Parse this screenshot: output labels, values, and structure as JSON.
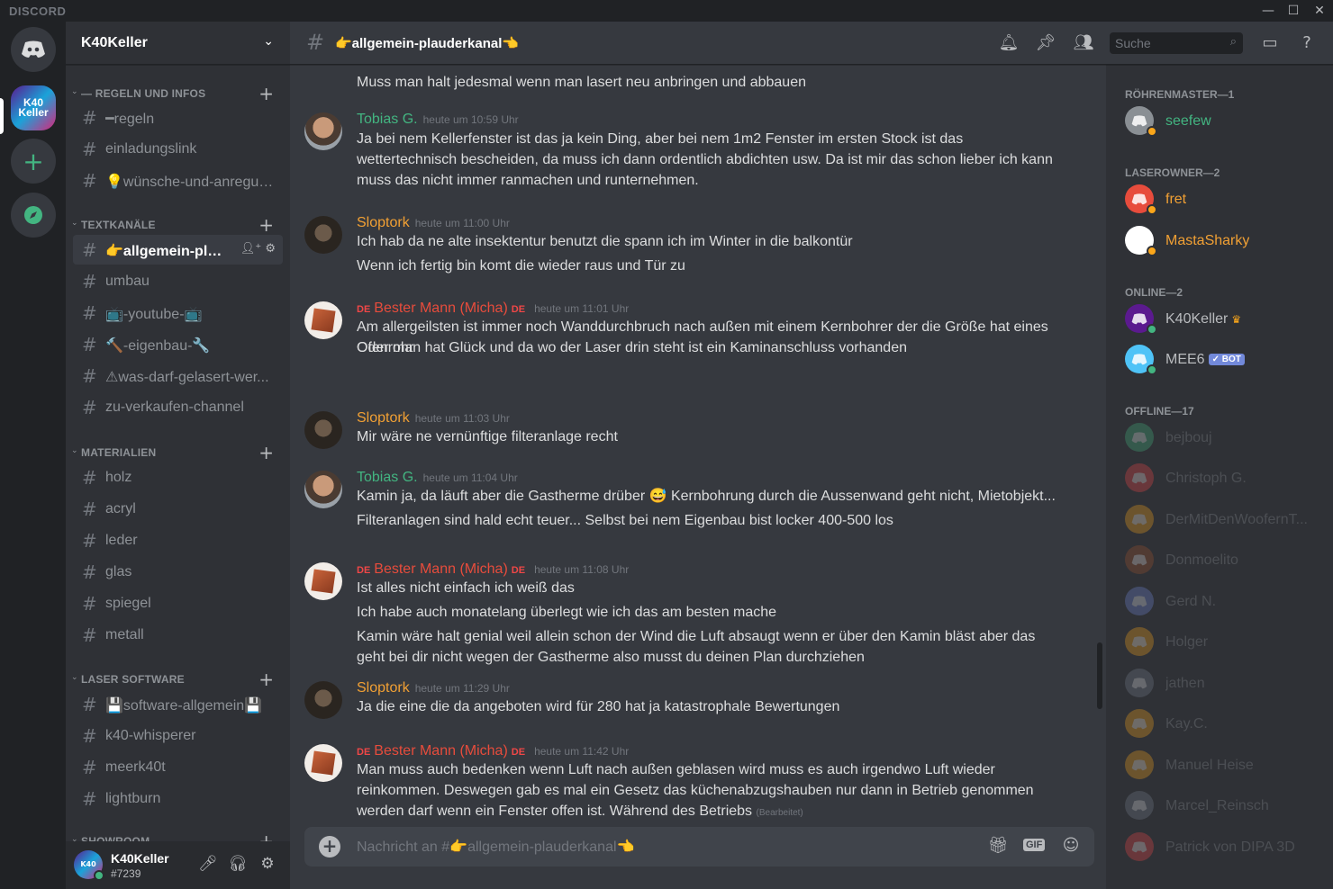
{
  "window": {
    "brand": "DISCORD",
    "minimize": "—",
    "maximize": "☐",
    "close": "✕"
  },
  "guild": {
    "name": "K40Keller",
    "icon_text": "K40\nKeller"
  },
  "categories": [
    {
      "label": "— REGELN UND INFOS",
      "channels": [
        {
          "name": "━regeln"
        },
        {
          "name": "einladungslink"
        },
        {
          "name": "💡wünsche-und-anregun..."
        }
      ]
    },
    {
      "label": "TEXTKANÄLE",
      "channels": [
        {
          "name": "👉allgemein-plaud...",
          "active": true
        },
        {
          "name": "umbau"
        },
        {
          "name": "📺-youtube-📺"
        },
        {
          "name": "🔨-eigenbau-🔧"
        },
        {
          "name": "⚠was-darf-gelasert-wer..."
        },
        {
          "name": "zu-verkaufen-channel"
        }
      ]
    },
    {
      "label": "MATERIALIEN",
      "channels": [
        {
          "name": "holz"
        },
        {
          "name": "acryl"
        },
        {
          "name": "leder"
        },
        {
          "name": "glas"
        },
        {
          "name": "spiegel"
        },
        {
          "name": "metall"
        }
      ]
    },
    {
      "label": "LASER SOFTWARE",
      "channels": [
        {
          "name": "💾software-allgemein💾"
        },
        {
          "name": "k40-whisperer"
        },
        {
          "name": "meerk40t"
        },
        {
          "name": "lightburn"
        }
      ]
    },
    {
      "label": "SHOWROOM",
      "channels": []
    }
  ],
  "user_panel": {
    "name": "K40Keller",
    "tag": "#7239"
  },
  "topbar": {
    "channel": "👉allgemein-plauderkanal👈",
    "search_placeholder": "Suche"
  },
  "messages": [
    {
      "text_lines": [
        "Muss man halt jedesmal wenn man lasert neu anbringen und abbauen"
      ]
    },
    {
      "author": "Tobias G.",
      "color": "#43b581",
      "ts": "heute um 10:59 Uhr",
      "avatar": "tobias",
      "text_lines": [
        "Ja bei nem Kellerfenster ist das ja kein Ding, aber bei nem 1m2 Fenster im ersten Stock ist das wettertechnisch bescheiden, da muss ich dann ordentlich abdichten usw. Da ist mir das schon lieber ich kann muss das nicht immer ranmachen und runternehmen."
      ]
    },
    {
      "author": "Sloptork",
      "color": "#f1a034",
      "ts": "heute um 11:00 Uhr",
      "avatar": "sloptork",
      "text_lines": [
        "Ich hab da ne alte insektentur benutzt die spann ich im Winter in die balkontür",
        "Wenn ich fertig bin komt die wieder raus und Tür zu"
      ]
    },
    {
      "author": "Bester Mann (Micha)",
      "color": "#e74c3c",
      "ts": "heute um 11:01 Uhr",
      "avatar": "micha",
      "flag": "DE",
      "text_lines": [
        "Am allergeilsten ist immer noch Wanddurchbruch nach außen mit einem Kernbohrer der die Größe hat eines Ofenrohr",
        "Oder man hat Glück und da wo der Laser drin steht ist ein Kaminanschluss vorhanden"
      ]
    },
    {
      "author": "Sloptork",
      "color": "#f1a034",
      "ts": "heute um 11:03 Uhr",
      "avatar": "sloptork",
      "text_lines": [
        "Mir wäre ne vernünftige filteranlage recht"
      ]
    },
    {
      "author": "Tobias G.",
      "color": "#43b581",
      "ts": "heute um 11:04 Uhr",
      "avatar": "tobias",
      "text_lines": [
        "Kamin ja, da läuft aber die Gastherme drüber 😅 Kernbohrung durch die Aussenwand geht nicht, Mietobjekt...",
        "Filteranlagen sind hald echt teuer... Selbst bei nem Eigenbau bist locker 400-500 los"
      ]
    },
    {
      "author": "Bester Mann (Micha)",
      "color": "#e74c3c",
      "ts": "heute um 11:08 Uhr",
      "avatar": "micha",
      "flag": "DE",
      "text_lines": [
        "Ist alles nicht einfach ich weiß das",
        "Ich habe auch monatelang überlegt wie ich das am besten mache",
        "Kamin wäre halt genial weil allein schon der Wind die Luft absaugt wenn er über den Kamin bläst aber das geht bei dir nicht wegen der Gastherme also musst du deinen Plan durchziehen"
      ]
    },
    {
      "author": "Sloptork",
      "color": "#f1a034",
      "ts": "heute um 11:29 Uhr",
      "avatar": "sloptork",
      "text_lines": [
        "Ja die eine die da angeboten wird für 280 hat ja katastrophale Bewertungen"
      ]
    },
    {
      "author": "Bester Mann (Micha)",
      "color": "#e74c3c",
      "ts": "heute um 11:42 Uhr",
      "avatar": "micha",
      "flag": "DE",
      "text_lines": [
        "Man muss auch bedenken wenn Luft nach außen geblasen wird muss es auch irgendwo Luft wieder reinkommen. Deswegen gab es mal ein Gesetz das küchenabzugshauben nur dann in Betrieb genommen werden darf wenn ein Fenster offen ist. Während des Betriebs"
      ],
      "edited": "(Bearbeitet)"
    }
  ],
  "composer": {
    "placeholder": "Nachricht an #👉allgemein-plauderkanal👈",
    "gif": "GIF"
  },
  "member_groups": [
    {
      "label": "RÖHRENMASTER—1",
      "members": [
        {
          "name": "seefew",
          "color": "#43b581",
          "avatar": "#8a8f94",
          "status": "#faa61a"
        }
      ]
    },
    {
      "label": "LASEROWNER—2",
      "members": [
        {
          "name": "fret",
          "color": "#f1a034",
          "avatar": "#e74c3c",
          "status": "#faa61a"
        },
        {
          "name": "MastaSharky",
          "color": "#f1a034",
          "avatar": "#ffffff",
          "status": "#faa61a"
        }
      ]
    },
    {
      "label": "ONLINE—2",
      "members": [
        {
          "name": "K40Keller",
          "color": "#b9bbbe",
          "avatar": "#5b1a8f",
          "status": "#43b581",
          "crown": "♛"
        },
        {
          "name": "MEE6",
          "color": "#b9bbbe",
          "avatar": "#4fc3f7",
          "status": "#43b581",
          "bot": "✓ BOT"
        }
      ]
    },
    {
      "label": "OFFLINE—17",
      "members": [
        {
          "name": "bejbouj",
          "color": "#8e9297",
          "avatar": "#43b581",
          "offline": true
        },
        {
          "name": "Christoph G.",
          "color": "#8e9297",
          "avatar": "#f04747",
          "offline": true
        },
        {
          "name": "DerMitDenWoofernT...",
          "color": "#8e9297",
          "avatar": "#faa61a",
          "offline": true
        },
        {
          "name": "Donmoelito",
          "color": "#8e9297",
          "avatar": "#a0522d",
          "offline": true
        },
        {
          "name": "Gerd N.",
          "color": "#8e9297",
          "avatar": "#7289da",
          "offline": true
        },
        {
          "name": "Holger",
          "color": "#8e9297",
          "avatar": "#faa61a",
          "offline": true
        },
        {
          "name": "jathen",
          "color": "#8e9297",
          "avatar": "#747f8d",
          "offline": true
        },
        {
          "name": "Kay.C.",
          "color": "#8e9297",
          "avatar": "#faa61a",
          "offline": true
        },
        {
          "name": "Manuel Heise",
          "color": "#8e9297",
          "avatar": "#faa61a",
          "offline": true
        },
        {
          "name": "Marcel_Reinsch",
          "color": "#8e9297",
          "avatar": "#747f8d",
          "offline": true
        },
        {
          "name": "Patrick von DIPA 3D",
          "color": "#8e9297",
          "avatar": "#f04747",
          "offline": true
        }
      ]
    }
  ]
}
